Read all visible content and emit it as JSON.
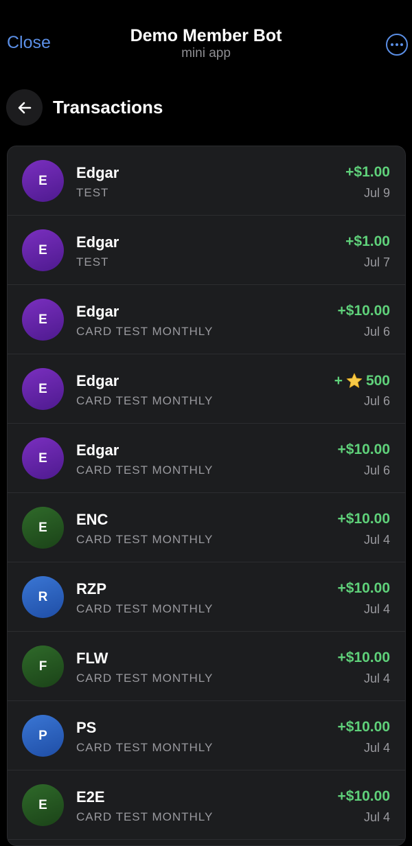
{
  "topbar": {
    "close_label": "Close",
    "title": "Demo Member Bot",
    "subtitle": "mini app",
    "more_icon": "more-icon",
    "accent": "#5b8fe6"
  },
  "header": {
    "back_icon": "arrow-left-icon",
    "title": "Transactions"
  },
  "transactions": [
    {
      "initial": "E",
      "name": "Edgar",
      "description": "TEST",
      "amount": "+$1.00",
      "date": "Jul 9",
      "avatar_color": "purple"
    },
    {
      "initial": "E",
      "name": "Edgar",
      "description": "TEST",
      "amount": "+$1.00",
      "date": "Jul 7",
      "avatar_color": "purple"
    },
    {
      "initial": "E",
      "name": "Edgar",
      "description": "CARD TEST MONTHLY",
      "amount": "+$10.00",
      "date": "Jul 6",
      "avatar_color": "purple"
    },
    {
      "initial": "E",
      "name": "Edgar",
      "description": "CARD TEST MONTHLY",
      "amount_prefix": "+",
      "amount": "500",
      "amount_icon": "star-icon",
      "date": "Jul 6",
      "avatar_color": "purple"
    },
    {
      "initial": "E",
      "name": "Edgar",
      "description": "CARD TEST MONTHLY",
      "amount": "+$10.00",
      "date": "Jul 6",
      "avatar_color": "purple"
    },
    {
      "initial": "E",
      "name": "ENC",
      "description": "CARD TEST MONTHLY",
      "amount": "+$10.00",
      "date": "Jul 4",
      "avatar_color": "green"
    },
    {
      "initial": "R",
      "name": "RZP",
      "description": "CARD TEST MONTHLY",
      "amount": "+$10.00",
      "date": "Jul 4",
      "avatar_color": "blue"
    },
    {
      "initial": "F",
      "name": "FLW",
      "description": "CARD TEST MONTHLY",
      "amount": "+$10.00",
      "date": "Jul 4",
      "avatar_color": "green"
    },
    {
      "initial": "P",
      "name": "PS",
      "description": "CARD TEST MONTHLY",
      "amount": "+$10.00",
      "date": "Jul 4",
      "avatar_color": "blue"
    },
    {
      "initial": "E",
      "name": "E2E",
      "description": "CARD TEST MONTHLY",
      "amount": "+$10.00",
      "date": "Jul 4",
      "avatar_color": "green"
    }
  ],
  "colors": {
    "amount_green": "#5fd17a",
    "secondary_text": "#9a9a9f",
    "card_bg": "#1c1d1f"
  }
}
